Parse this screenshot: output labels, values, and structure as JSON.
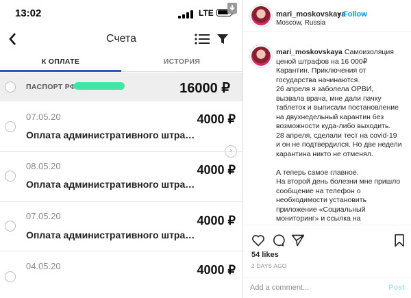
{
  "phone": {
    "status": {
      "time": "13:02",
      "network": "LTE"
    },
    "nav": {
      "back": "<",
      "title": "Счета"
    },
    "tabs": [
      {
        "label": "К ОПЛАТЕ"
      },
      {
        "label": "ИСТОРИЯ"
      }
    ],
    "passport": {
      "label": "ПАСПОРТ РФ",
      "amount": "16000 ₽"
    },
    "fines": [
      {
        "date": "07.05.20",
        "title": "Оплата административного штрафа п...",
        "amount": "4000 ₽"
      },
      {
        "date": "08.05.20",
        "title": "Оплата административного штрафа п...",
        "amount": "4000 ₽"
      },
      {
        "date": "07.05.20",
        "title": "Оплата административного штрафа п...",
        "amount": "4000 ₽"
      },
      {
        "date": "04.05.20",
        "title": "",
        "amount": "4000 ₽"
      }
    ],
    "chevron": "›"
  },
  "instagram": {
    "header": {
      "username": "mari_moskovskaya",
      "separator": "•",
      "follow": "Follow",
      "location": "Moscow, Russia",
      "more": "..."
    },
    "caption": {
      "username": "mari_moskovskaya",
      "lines": [
        "Самоизоляция ценой штрафов на 16 000₽",
        "Карантин. Приключения от государства начинаются.",
        "26 апреля я заболела ОРВИ, вызвала врача, мне дали пачку таблеток и выписали постановление на двухнедельный карантин без возможности куда-либо выходить.",
        "28 апреля, сделали тест на covid-19 и он не подтвердился. Но две недели карантина никто не отменял."
      ],
      "lines2": [
        "А теперь самое главное.",
        "На второй день болезни мне пришло сообщение на телефон о необходимости установить приложение «Социальный мониторинг» и ссылка на скачивание. Приложение"
      ]
    },
    "likes": "54 likes",
    "time_ago": "2 DAYS AGO",
    "comment_placeholder": "Add a comment...",
    "post_label": "Post",
    "colors": {
      "follow": "#0095f6",
      "post_disabled": "#b2dffc",
      "tab_accent": "#2f57b5",
      "mask": "#3fe6a6"
    }
  }
}
